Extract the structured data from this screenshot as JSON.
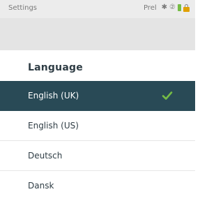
{
  "status_bar": {
    "title": "Settings",
    "right_text": "Prel",
    "icons": [
      "bluetooth-icon",
      "circled-2-icon",
      "battery-icon",
      "lock-icon"
    ],
    "bluetooth_glyph": "✱",
    "circled_glyph": "②"
  },
  "section": {
    "title": "Language"
  },
  "languages": [
    {
      "label": "English (UK)",
      "selected": true
    },
    {
      "label": "English (US)",
      "selected": false
    },
    {
      "label": "Deutsch",
      "selected": false
    },
    {
      "label": "Dansk",
      "selected": false
    }
  ],
  "colors": {
    "selected_background": "#294a56",
    "checkmark": "#76bc45",
    "header_band": "#e4e4e4",
    "status_bar": "#ececec"
  }
}
